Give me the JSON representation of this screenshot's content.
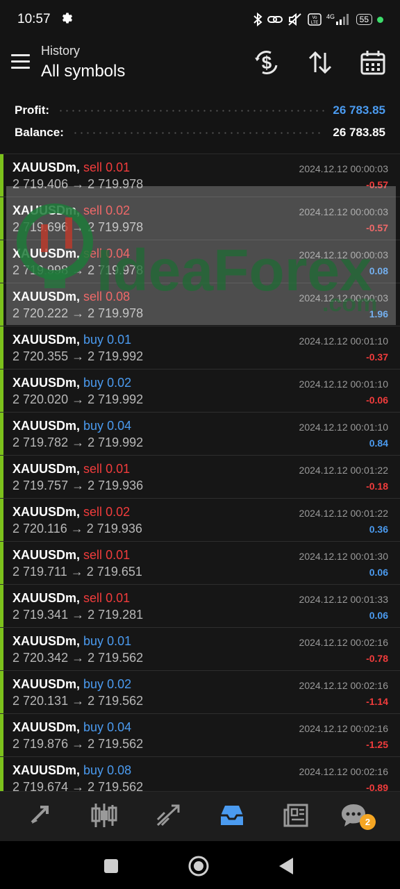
{
  "status_bar": {
    "time": "10:57",
    "network": "4G",
    "volte": "Vo LTE",
    "battery": "55"
  },
  "header": {
    "subtitle": "History",
    "title": "All symbols",
    "actions": [
      "currency-exchange-icon",
      "sort-icon",
      "calendar-icon"
    ]
  },
  "summary": {
    "profit_label": "Profit:",
    "profit_value": "26 783.85",
    "balance_label": "Balance:",
    "balance_value": "26 783.85"
  },
  "colors": {
    "sell": "#f23c3c",
    "buy": "#4b9bf0",
    "accent_bar": "#7cc11c",
    "badge": "#f5a623"
  },
  "watermark": {
    "brand": "IdeaForex",
    "domain": ".com"
  },
  "trades": [
    {
      "symbol": "XAUUSDm,",
      "side": "sell",
      "volume": "0.01",
      "open": "2 719.406",
      "close": "2 719.978",
      "time": "2024.12.12 00:00:03",
      "profit": "-0.57"
    },
    {
      "symbol": "XAUUSDm,",
      "side": "sell",
      "volume": "0.02",
      "open": "2 719.696",
      "close": "2 719.978",
      "time": "2024.12.12 00:00:03",
      "profit": "-0.57"
    },
    {
      "symbol": "XAUUSDm,",
      "side": "sell",
      "volume": "0.04",
      "open": "2 719.998",
      "close": "2 719.978",
      "time": "2024.12.12 00:00:03",
      "profit": "0.08"
    },
    {
      "symbol": "XAUUSDm,",
      "side": "sell",
      "volume": "0.08",
      "open": "2 720.222",
      "close": "2 719.978",
      "time": "2024.12.12 00:00:03",
      "profit": "1.96"
    },
    {
      "symbol": "XAUUSDm,",
      "side": "buy",
      "volume": "0.01",
      "open": "2 720.355",
      "close": "2 719.992",
      "time": "2024.12.12 00:01:10",
      "profit": "-0.37"
    },
    {
      "symbol": "XAUUSDm,",
      "side": "buy",
      "volume": "0.02",
      "open": "2 720.020",
      "close": "2 719.992",
      "time": "2024.12.12 00:01:10",
      "profit": "-0.06"
    },
    {
      "symbol": "XAUUSDm,",
      "side": "buy",
      "volume": "0.04",
      "open": "2 719.782",
      "close": "2 719.992",
      "time": "2024.12.12 00:01:10",
      "profit": "0.84"
    },
    {
      "symbol": "XAUUSDm,",
      "side": "sell",
      "volume": "0.01",
      "open": "2 719.757",
      "close": "2 719.936",
      "time": "2024.12.12 00:01:22",
      "profit": "-0.18"
    },
    {
      "symbol": "XAUUSDm,",
      "side": "sell",
      "volume": "0.02",
      "open": "2 720.116",
      "close": "2 719.936",
      "time": "2024.12.12 00:01:22",
      "profit": "0.36"
    },
    {
      "symbol": "XAUUSDm,",
      "side": "sell",
      "volume": "0.01",
      "open": "2 719.711",
      "close": "2 719.651",
      "time": "2024.12.12 00:01:30",
      "profit": "0.06"
    },
    {
      "symbol": "XAUUSDm,",
      "side": "sell",
      "volume": "0.01",
      "open": "2 719.341",
      "close": "2 719.281",
      "time": "2024.12.12 00:01:33",
      "profit": "0.06"
    },
    {
      "symbol": "XAUUSDm,",
      "side": "buy",
      "volume": "0.01",
      "open": "2 720.342",
      "close": "2 719.562",
      "time": "2024.12.12 00:02:16",
      "profit": "-0.78"
    },
    {
      "symbol": "XAUUSDm,",
      "side": "buy",
      "volume": "0.02",
      "open": "2 720.131",
      "close": "2 719.562",
      "time": "2024.12.12 00:02:16",
      "profit": "-1.14"
    },
    {
      "symbol": "XAUUSDm,",
      "side": "buy",
      "volume": "0.04",
      "open": "2 719.876",
      "close": "2 719.562",
      "time": "2024.12.12 00:02:16",
      "profit": "-1.25"
    },
    {
      "symbol": "XAUUSDm,",
      "side": "buy",
      "volume": "0.08",
      "open": "2 719.674",
      "close": "2 719.562",
      "time": "2024.12.12 00:02:16",
      "profit": "-0.89"
    }
  ],
  "bottom_nav": {
    "items": [
      "quotes-icon",
      "chart-icon",
      "trade-icon",
      "history-icon",
      "news-icon",
      "chat-icon"
    ],
    "active": "history-icon",
    "chat_badge": "2"
  },
  "system_nav": [
    "recents-button",
    "home-button",
    "back-button"
  ]
}
